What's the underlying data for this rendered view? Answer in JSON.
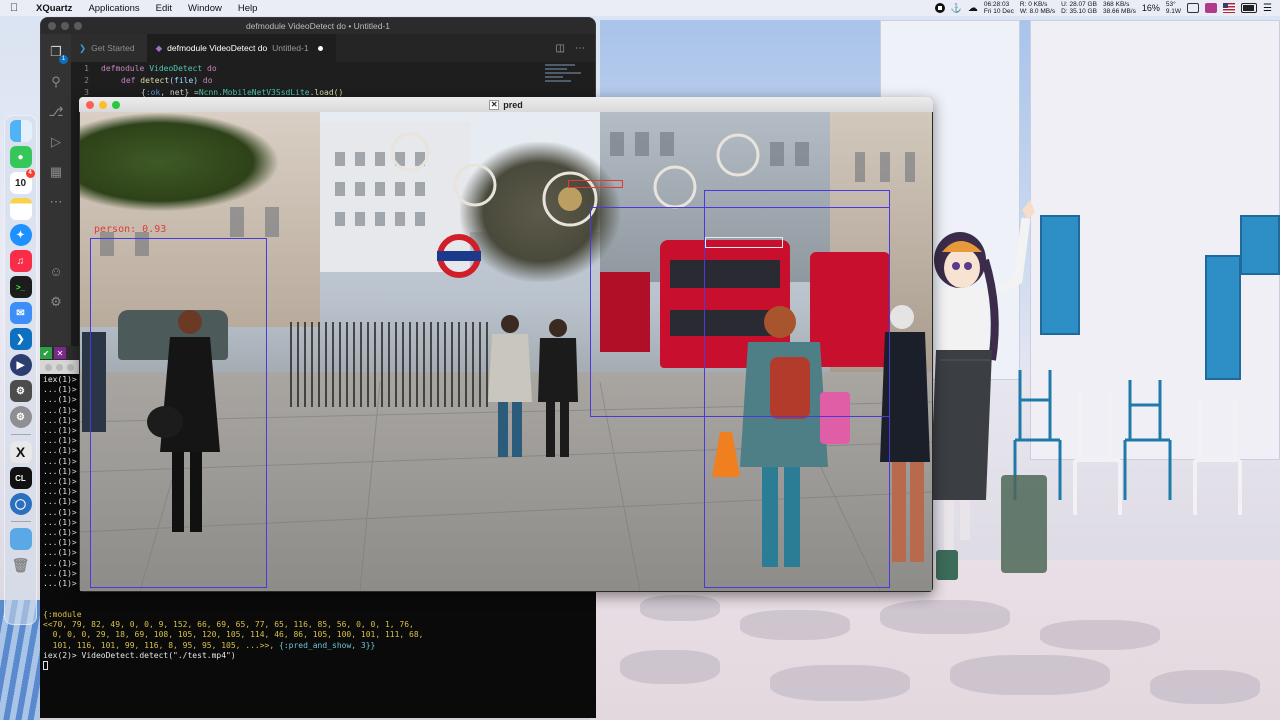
{
  "menubar": {
    "app_name": "XQuartz",
    "items": [
      "Applications",
      "Edit",
      "Window",
      "Help"
    ],
    "clock_time": "06:28:03",
    "clock_date": "Fri 10 Dec",
    "net_r_label": "R:",
    "net_r_val": "0 KB/s",
    "net_w_label": "W:",
    "net_w_val": "8.0 MB/s",
    "disk_u_label": "U:",
    "disk_u_val": "28.07 GB",
    "disk_d_label": "D:",
    "disk_d_val": "35.10 GB",
    "net_up": "368 KB/s",
    "net_down": "38.66 MB/s",
    "cpu": "16%",
    "temp": "53°",
    "power": "9.1W"
  },
  "dock": {
    "calendar_day": "10",
    "badges": {
      "calendar": "4",
      "finder": "1"
    }
  },
  "vscode": {
    "window_title": "defmodule VideoDetect do • Untitled-1",
    "tabs": [
      {
        "label": "Get Started",
        "sub": ""
      },
      {
        "label": "defmodule VideoDetect do",
        "sub": "Untitled-1"
      }
    ],
    "code": {
      "line1": {
        "num": "1",
        "kw": "defmodule",
        "name": "VideoDetect",
        "kw2": "do"
      },
      "line2": {
        "num": "2",
        "kw": "def",
        "fn": "detect",
        "args": "(file)",
        "kw2": "do"
      },
      "line3": {
        "num": "3",
        "prefix": "{",
        "atom": ":ok",
        "mid": ", net} = ",
        "mod": "Ncnn.MobileNetV3SsdLite",
        "call": ".load()"
      }
    },
    "activity_badge": "1"
  },
  "terminal": {
    "prompt_first": "iex(1)>",
    "continuation": "...(1)>",
    "continuation_count": 20,
    "module_line": "{:module",
    "binary_line1": "<<70, 79, 82, 49, 0, 0, 9, 152, 66, 69, 65, 77, 65, 116, 85, 56, 0, 0, 1, 76,",
    "binary_line2": "  0, 0, 0, 29, 18, 69, 108, 105, 120, 105, 114, 46, 86, 105, 100, 101, 111, 68,",
    "binary_line3_pre": "  101, 116, 101, 99, 116, 8, 95, 95, 105, ...>>, ",
    "binary_line3_tag": "{:pred_and_show, 3}}",
    "prompt2": "iex(2)> VideoDetect.detect(\"./test.mp4\")"
  },
  "pred_window": {
    "title": "pred",
    "detections": [
      {
        "label": "person: 0.93"
      }
    ]
  },
  "colors": {
    "vscode_bg": "#1e1e1e",
    "terminal_bg": "#0a0a0a",
    "detection_box": "#4a3adb",
    "detection_text": "#e03b3b",
    "bus_red": "#c8102e"
  }
}
